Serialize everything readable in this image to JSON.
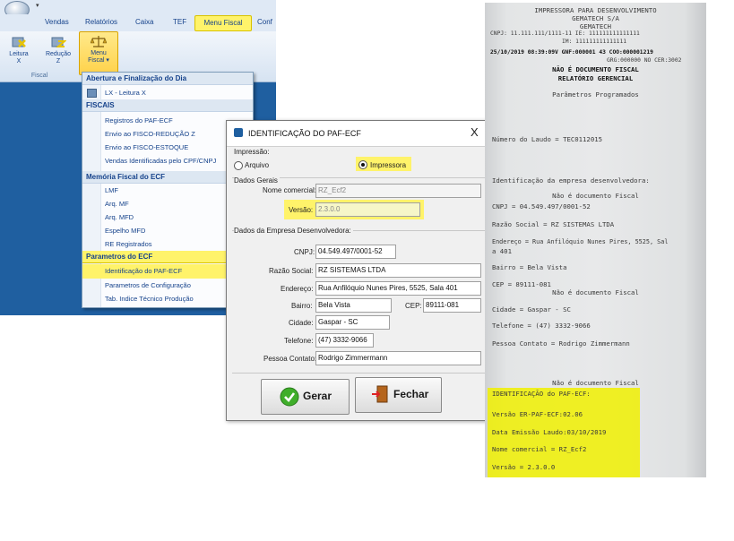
{
  "ribbon": {
    "tabs": [
      "Vendas",
      "Relatórios",
      "Caixa",
      "TEF",
      "Menu Fiscal",
      "Conf"
    ],
    "buttons": [
      {
        "label1": "Leitura",
        "label2": "X"
      },
      {
        "label1": "Redução",
        "label2": "Z"
      },
      {
        "label1": "Menu",
        "label2": "Fiscal ▾"
      }
    ],
    "group_label": "Fiscal"
  },
  "menu": {
    "sections": [
      {
        "header": "Abertura e Finalização do Dia",
        "items": [
          "LX - Leitura X"
        ]
      },
      {
        "header": "FISCAIS",
        "items": [
          "Registros do PAF-ECF",
          "Envio ao FISCO-REDUÇÃO Z",
          "Envio ao FISCO-ESTOQUE",
          "Vendas Identificadas pelo CPF/CNPJ"
        ]
      },
      {
        "header": "Memória Fiscal do ECF",
        "items": [
          "LMF",
          "Arq. MF",
          "Arq. MFD",
          "Espelho MFD",
          "RE Registrados"
        ]
      },
      {
        "header": "Parametros do ECF",
        "items": [
          "Identificação do PAF-ECF",
          "Parametros de Configuração",
          "Tab. Indice Técnico Produção"
        ]
      }
    ]
  },
  "dialog": {
    "title": "IDENTIFICAÇÃO DO PAF-ECF",
    "close": "X",
    "impressao_label": "Impressão:",
    "radio_arquivo": "Arquivo",
    "radio_impressora": "Impressora",
    "dados_gerais": "Dados Gerais",
    "nome_comercial_label": "Nome comercial:",
    "nome_comercial_value": "RZ_Ecf2",
    "versao_label": "Versão:",
    "versao_value": "2.3.0.0",
    "dados_empresa": "Dados da Empresa Desenvolvedora:",
    "cnpj_label": "CNPJ:",
    "cnpj_value": "04.549.497/0001-52",
    "razao_label": "Razão Social:",
    "razao_value": "RZ SISTEMAS LTDA",
    "endereco_label": "Endereço:",
    "endereco_value": "Rua Anfilóquio Nunes Pires, 5525, Sala 401",
    "bairro_label": "Bairro:",
    "bairro_value": "Bela Vista",
    "cep_label": "CEP:",
    "cep_value": "89111-081",
    "cidade_label": "Cidade:",
    "cidade_value": "Gaspar - SC",
    "telefone_label": "Telefone:",
    "telefone_value": "(47) 3332-9066",
    "contato_label": "Pessoa Contato:",
    "contato_value": "Rodrigo Zimmermann",
    "btn_gerar": "Gerar",
    "btn_fechar": "Fechar"
  },
  "receipt": {
    "lines": [
      "IMPRESSORA PARA DESENVOLVIMENTO",
      "GEMATECH S/A",
      "GEMATECH",
      "CNPJ: 11.111.111/1111-11 IE: 111111111111111",
      "IM: 111111111111111",
      "25/10/2019 08:39:09V GNF:000001 43 COO:000001219",
      "GRG:000000 NO CER:3002",
      "NÃO É DOCUMENTO FISCAL",
      "RELATÓRIO GERENCIAL",
      "Parâmetros Programados",
      "Número do Laudo = TEC0112015",
      "Identificação da empresa desenvolvedora:",
      "Não é documento Fiscal",
      "CNPJ = 04.549.497/0001-52",
      "Razão Social = RZ SISTEMAS LTDA",
      "Endereço = Rua Anfilóquio Nunes Pires, 5525, Sal",
      "a 401",
      "Bairro = Bela Vista",
      "CEP = 89111-081",
      "Não é documento Fiscal",
      "Cidade = Gaspar - SC",
      "Telefone = (47) 3332-9066",
      "Pessoa Contato = Rodrigo Zimmermann",
      "Não é documento Fiscal",
      "IDENTIFICAÇÃO do PAF-ECF:",
      "Versão ER-PAF-ECF:02.06",
      "Data Emissão Laudo:03/10/2019",
      "Nome comercial = RZ_Ecf2",
      "Versão = 2.3.0.0"
    ]
  },
  "colors": {
    "highlight": "#fff36a",
    "ribbon_blue": "#1f5fa0",
    "menu_text": "#15428b"
  }
}
